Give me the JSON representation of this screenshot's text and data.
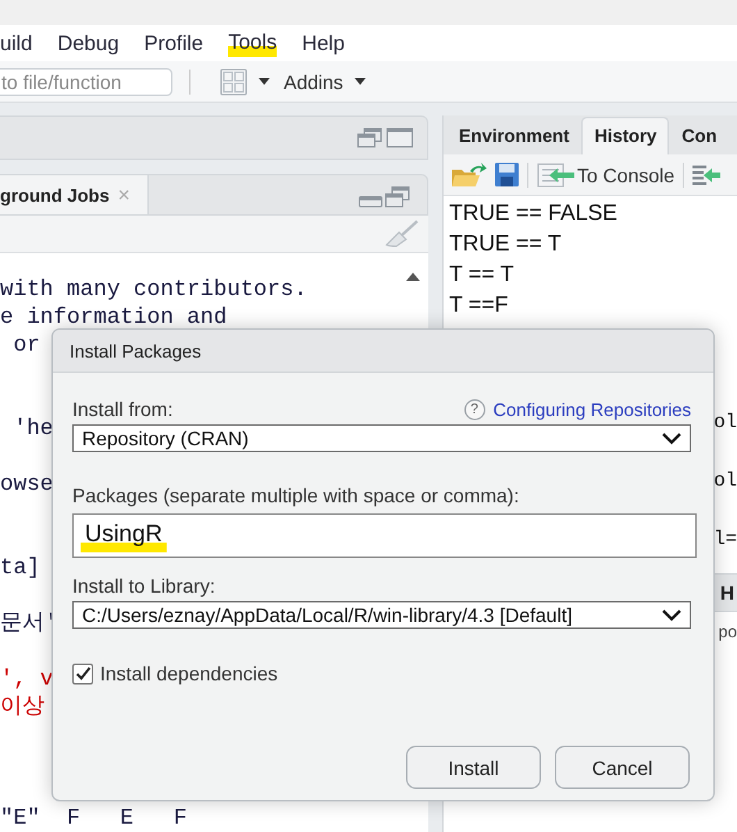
{
  "menu": [
    {
      "label": "uild",
      "highlighted": false
    },
    {
      "label": "Debug",
      "highlighted": false
    },
    {
      "label": "Profile",
      "highlighted": false
    },
    {
      "label": "Tools",
      "highlighted": true
    },
    {
      "label": "Help",
      "highlighted": false
    }
  ],
  "toolbar": {
    "goto_placeholder": "to file/function",
    "addins": "Addins"
  },
  "left_pane": {
    "tab": "ground Jobs",
    "close": "×",
    "console_lines": [
      {
        "kind": "text",
        "text": "with many contributors."
      },
      {
        "kind": "text",
        "text": "e information and"
      },
      {
        "kind": "text",
        "text": " or"
      },
      {
        "kind": "blank"
      },
      {
        "kind": "blank"
      },
      {
        "kind": "text",
        "text": " 'he"
      },
      {
        "kind": "blank"
      },
      {
        "kind": "text",
        "text": "owse"
      },
      {
        "kind": "blank"
      },
      {
        "kind": "blank"
      },
      {
        "kind": "text",
        "text": "ta]"
      },
      {
        "kind": "blank"
      },
      {
        "kind": "text",
        "text": "문서'"
      },
      {
        "kind": "blank"
      },
      {
        "kind": "error",
        "text": "', v"
      },
      {
        "kind": "error",
        "text": "이상"
      },
      {
        "kind": "blank"
      },
      {
        "kind": "blank"
      },
      {
        "kind": "blank"
      },
      {
        "kind": "text",
        "text": "\"E\"  F   E   F"
      }
    ]
  },
  "right_pane": {
    "tabs": [
      {
        "label": "Environment",
        "selected": false
      },
      {
        "label": "History",
        "selected": true
      },
      {
        "label": "Con",
        "selected": false
      }
    ],
    "to_console": "To Console",
    "history": [
      "TRUE == FALSE",
      "TRUE == T",
      "T == T",
      "T ==F"
    ],
    "hidden_fragment_list": [
      {
        "kind": "blank"
      },
      {
        "kind": "blank"
      },
      {
        "kind": "blank"
      },
      {
        "kind": "text",
        "text": "ol"
      },
      {
        "kind": "blank"
      },
      {
        "kind": "text",
        "text": "ol"
      },
      {
        "kind": "blank"
      },
      {
        "kind": "text",
        "text": "l="
      }
    ],
    "lower_tab": "H",
    "lower_text": "po"
  },
  "dialog": {
    "title": "Install Packages",
    "install_from_label": "Install from:",
    "help_icon": "?",
    "help_link": "Configuring Repositories",
    "install_from": "Repository (CRAN)",
    "packages_label": "Packages (separate multiple with space or comma):",
    "packages": "UsingR",
    "packages_highlighted": true,
    "library_label": "Install to Library:",
    "library": "C:/Users/eznay/AppData/Local/R/win-library/4.3 [Default]",
    "dependencies": {
      "label": "Install dependencies",
      "checked": true
    },
    "buttons": [
      "Install",
      "Cancel"
    ]
  }
}
